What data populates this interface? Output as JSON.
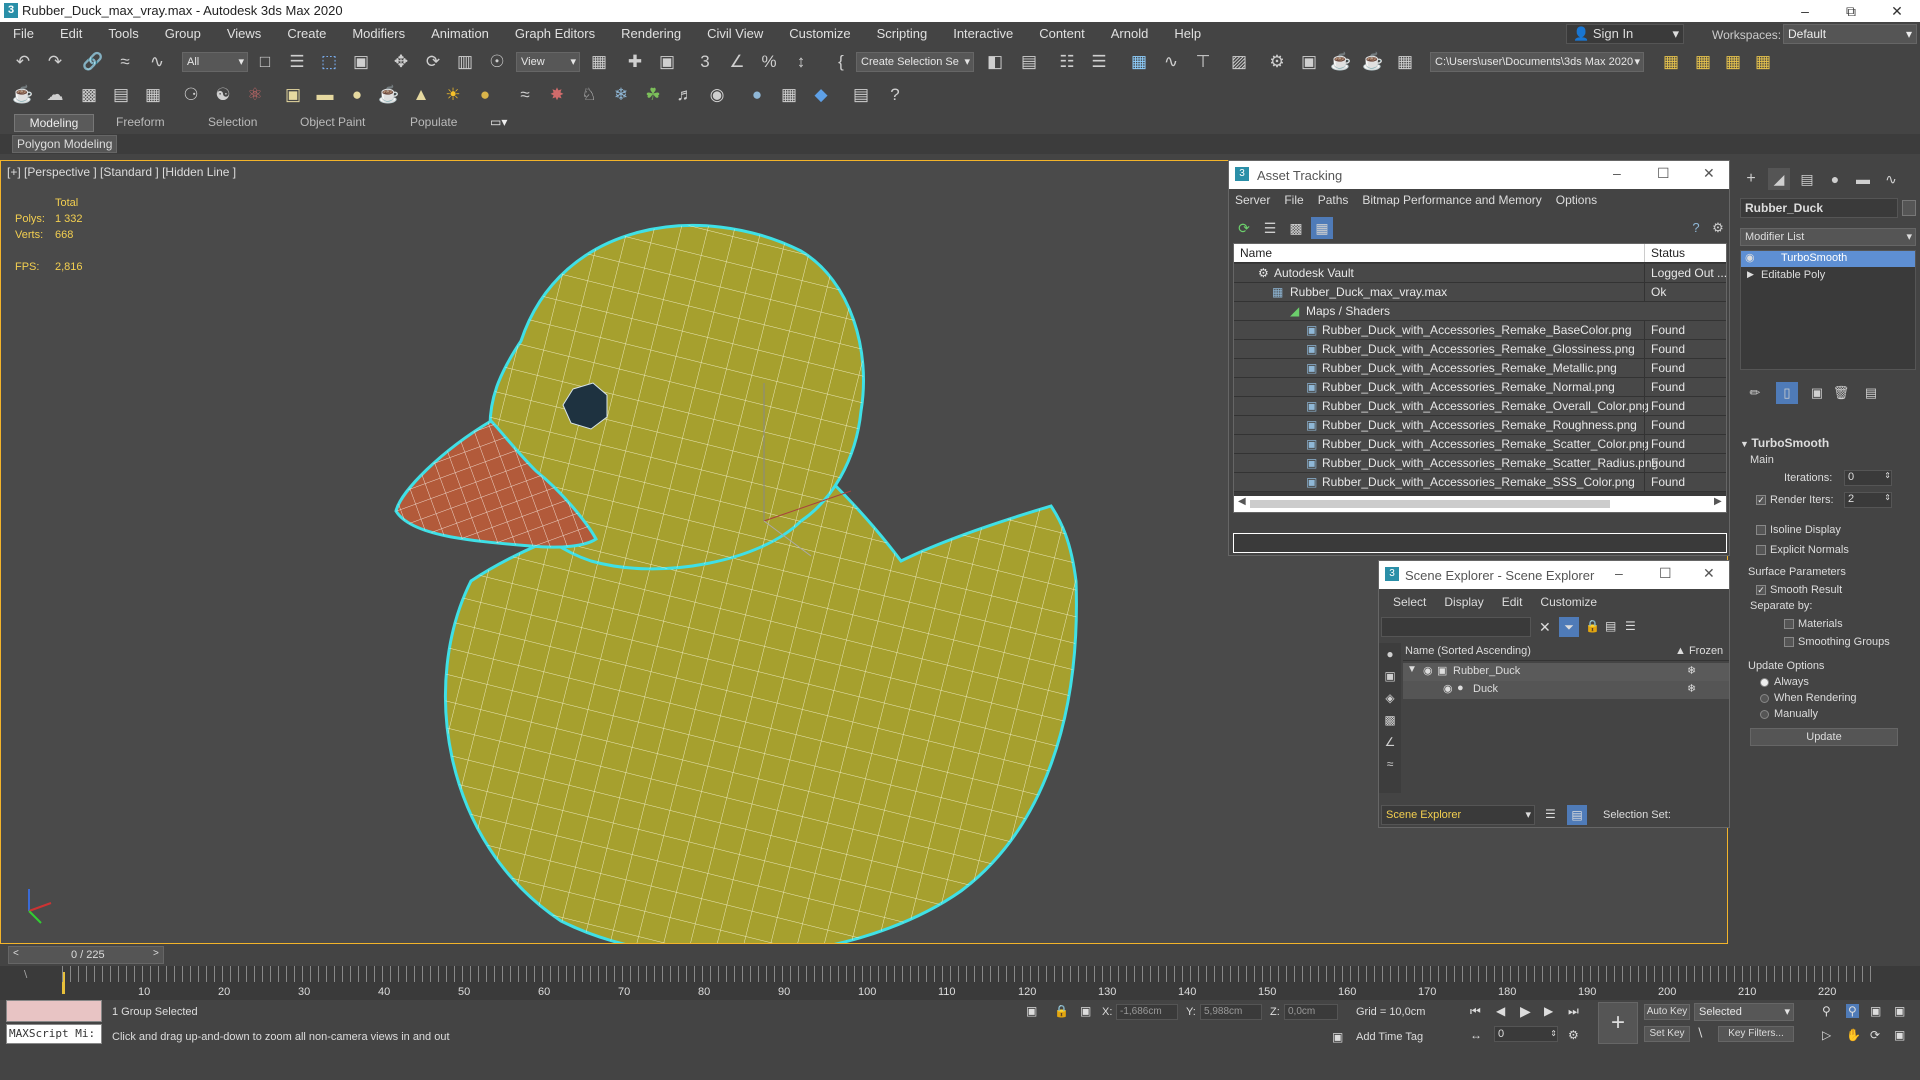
{
  "window": {
    "title": "Rubber_Duck_max_vray.max - Autodesk 3ds Max 2020",
    "app_letter": "3"
  },
  "menu": [
    "File",
    "Edit",
    "Tools",
    "Group",
    "Views",
    "Create",
    "Modifiers",
    "Animation",
    "Graph Editors",
    "Rendering",
    "Civil View",
    "Customize",
    "Scripting",
    "Interactive",
    "Content",
    "Arnold",
    "Help"
  ],
  "signin": "Sign In",
  "workspaces": {
    "label": "Workspaces:",
    "value": "Default"
  },
  "toolbar": {
    "filter": "All",
    "view_ref": "View",
    "selection_set": "Create Selection Se",
    "project_path": "C:\\Users\\user\\Documents\\3ds Max 2020"
  },
  "ribbon": {
    "tabs": [
      "Modeling",
      "Freeform",
      "Selection",
      "Object Paint",
      "Populate"
    ],
    "active": "Modeling",
    "sub": "Polygon Modeling"
  },
  "viewport": {
    "label": "[+] [Perspective ] [Standard ] [Hidden Line ]",
    "stats": {
      "total": "Total",
      "polys_label": "Polys:",
      "polys": "1 332",
      "verts_label": "Verts:",
      "verts": "668",
      "fps_label": "FPS:",
      "fps": "2,816"
    },
    "axis": {
      "x": "x",
      "y": "y",
      "z": "z"
    }
  },
  "asset_tracking": {
    "title": "Asset Tracking",
    "menu": [
      "Server",
      "File",
      "Paths",
      "Bitmap Performance and Memory",
      "Options"
    ],
    "columns": [
      "Name",
      "Status"
    ],
    "rows": [
      {
        "name": "Autodesk Vault",
        "status": "Logged Out ..."
      },
      {
        "name": "Rubber_Duck_max_vray.max",
        "status": "Ok"
      },
      {
        "name": "Maps / Shaders",
        "status": ""
      },
      {
        "name": "Rubber_Duck_with_Accessories_Remake_BaseColor.png",
        "status": "Found"
      },
      {
        "name": "Rubber_Duck_with_Accessories_Remake_Glossiness.png",
        "status": "Found"
      },
      {
        "name": "Rubber_Duck_with_Accessories_Remake_Metallic.png",
        "status": "Found"
      },
      {
        "name": "Rubber_Duck_with_Accessories_Remake_Normal.png",
        "status": "Found"
      },
      {
        "name": "Rubber_Duck_with_Accessories_Remake_Overall_Color.png",
        "status": "Found"
      },
      {
        "name": "Rubber_Duck_with_Accessories_Remake_Roughness.png",
        "status": "Found"
      },
      {
        "name": "Rubber_Duck_with_Accessories_Remake_Scatter_Color.png",
        "status": "Found"
      },
      {
        "name": "Rubber_Duck_with_Accessories_Remake_Scatter_Radius.png",
        "status": "Found"
      },
      {
        "name": "Rubber_Duck_with_Accessories_Remake_SSS_Color.png",
        "status": "Found"
      }
    ]
  },
  "scene_explorer": {
    "title": "Scene Explorer - Scene Explorer",
    "menu": [
      "Select",
      "Display",
      "Edit",
      "Customize"
    ],
    "col_name": "Name (Sorted Ascending)",
    "col_frozen": "▲ Frozen",
    "items": [
      "Rubber_Duck",
      "Duck"
    ],
    "explorer_sel": "Scene Explorer",
    "selection_set_label": "Selection Set:"
  },
  "command_panel": {
    "object_name": "Rubber_Duck",
    "modifier_list": "Modifier List",
    "stack": [
      "TurboSmooth",
      "Editable Poly"
    ],
    "rollout_title": "TurboSmooth",
    "main": "Main",
    "iterations_label": "Iterations:",
    "iterations": "0",
    "render_iters_label": "Render Iters:",
    "render_iters": "2",
    "isoline": "Isoline Display",
    "explicit_normals": "Explicit Normals",
    "surface_params": "Surface Parameters",
    "smooth_result": "Smooth Result",
    "separate_by": "Separate by:",
    "materials": "Materials",
    "smoothing_groups": "Smoothing Groups",
    "update_options": "Update Options",
    "always": "Always",
    "when_rendering": "When Rendering",
    "manually": "Manually",
    "update_button": "Update"
  },
  "timeline": {
    "frame": "0 / 225",
    "ticks": [
      "10",
      "20",
      "30",
      "40",
      "50",
      "60",
      "70",
      "80",
      "90",
      "100",
      "110",
      "120",
      "130",
      "140",
      "150",
      "160",
      "170",
      "180",
      "190",
      "200",
      "210",
      "220"
    ]
  },
  "status": {
    "maxscript": "MAXScript Mi:",
    "selected": "1 Group Selected",
    "hint": "Click and drag up-and-down to zoom all non-camera views in and out",
    "x_label": "X:",
    "x": "-1,686cm",
    "y_label": "Y:",
    "y": "5,988cm",
    "z_label": "Z:",
    "z": "0,0cm",
    "grid": "Grid = 10,0cm",
    "add_time_tag": "Add Time Tag",
    "auto_key": "Auto Key",
    "selected_dd": "Selected",
    "set_key": "Set Key",
    "key_filters": "Key Filters...",
    "frame_field": "0"
  },
  "colors": {
    "duck_yellow": "#a6a02e",
    "beak": "#b25a3a",
    "selection_outline": "#3fe0e6",
    "viewport_border": "#f3b42a"
  }
}
